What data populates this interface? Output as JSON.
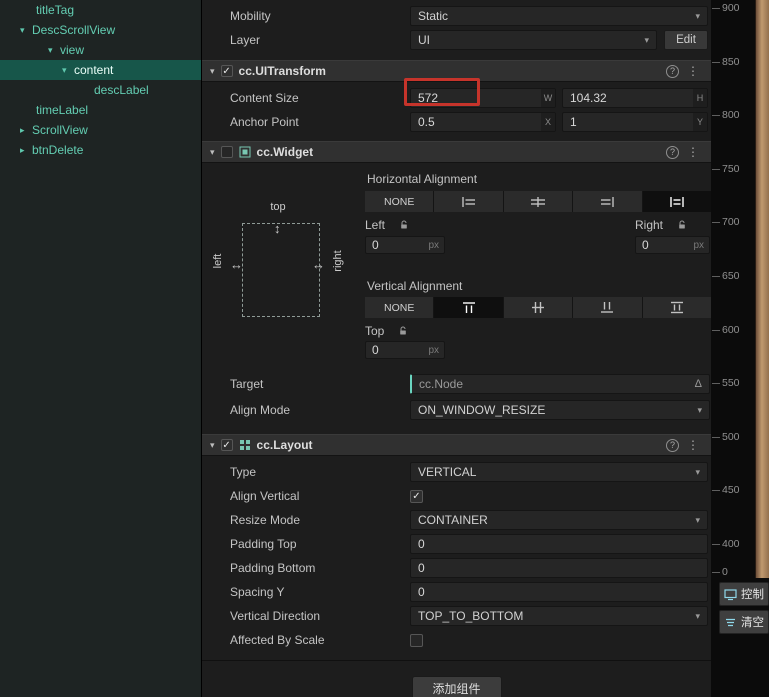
{
  "icons": {
    "caret": "▾",
    "check": "✓",
    "help": "?",
    "menu": "⋮",
    "arrow_v": "↕",
    "arrow_h": "↔",
    "node_badge": "Δ"
  },
  "hierarchy": {
    "items": [
      {
        "label": "titleTag",
        "chevron": ""
      },
      {
        "label": "DescScrollView",
        "chevron": "▾"
      },
      {
        "label": "view",
        "chevron": "▾"
      },
      {
        "label": "content",
        "chevron": "▾",
        "selected": true
      },
      {
        "label": "descLabel",
        "chevron": ""
      },
      {
        "label": "timeLabel",
        "chevron": ""
      },
      {
        "label": "ScrollView",
        "chevron": "▸"
      },
      {
        "label": "btnDelete",
        "chevron": "▸"
      }
    ]
  },
  "inspector": {
    "node": {
      "mobility_label": "Mobility",
      "mobility_value": "Static",
      "layer_label": "Layer",
      "layer_value": "UI",
      "edit_label": "Edit"
    },
    "uitransform": {
      "title": "cc.UITransform",
      "content_size_label": "Content Size",
      "width_value": "572",
      "width_suffix": "W",
      "height_value": "104.32",
      "height_suffix": "H",
      "anchor_label": "Anchor Point",
      "anchor_x": "0.5",
      "anchor_x_suffix": "X",
      "anchor_y": "1",
      "anchor_y_suffix": "Y"
    },
    "widget": {
      "title": "cc.Widget",
      "horizontal_alignment_label": "Horizontal Alignment",
      "h_none_label": "NONE",
      "left_label": "Left",
      "left_value": "0",
      "left_unit": "px",
      "right_label": "Right",
      "right_value": "0",
      "right_unit": "px",
      "vertical_alignment_label": "Vertical Alignment",
      "v_none_label": "NONE",
      "top_label": "Top",
      "top_value": "0",
      "top_unit": "px",
      "diagram_top": "top",
      "diagram_left": "left",
      "diagram_right": "right",
      "target_label": "Target",
      "target_value": "cc.Node",
      "align_mode_label": "Align Mode",
      "align_mode_value": "ON_WINDOW_RESIZE"
    },
    "layout": {
      "title": "cc.Layout",
      "type_label": "Type",
      "type_value": "VERTICAL",
      "align_vertical_label": "Align Vertical",
      "resize_mode_label": "Resize Mode",
      "resize_mode_value": "CONTAINER",
      "padding_top_label": "Padding Top",
      "padding_top_value": "0",
      "padding_bottom_label": "Padding Bottom",
      "padding_bottom_value": "0",
      "spacing_y_label": "Spacing Y",
      "spacing_y_value": "0",
      "vertical_direction_label": "Vertical Direction",
      "vertical_direction_value": "TOP_TO_BOTTOM",
      "affected_by_scale_label": "Affected By Scale"
    },
    "add_component_label": "添加组件"
  },
  "scene": {
    "ruler_ticks": [
      "900",
      "850",
      "800",
      "750",
      "700",
      "650",
      "600",
      "550",
      "500",
      "450",
      "400",
      "0"
    ],
    "buttons": [
      {
        "label": "控制"
      },
      {
        "label": "清空"
      }
    ]
  },
  "colors": {
    "accent": "#5fc8ae",
    "annotation": "#c6342b"
  }
}
